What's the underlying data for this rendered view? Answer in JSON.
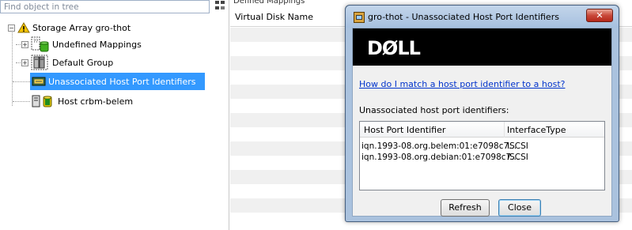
{
  "tree": {
    "find_placeholder": "Find object in tree",
    "items": [
      {
        "label": "Storage Array gro-thot",
        "icon": "warning-icon"
      },
      {
        "label": "Undefined Mappings",
        "icon": "undefined-mappings-icon"
      },
      {
        "label": "Default Group",
        "icon": "host-group-icon"
      },
      {
        "label": "Unassociated Host Port Identifiers",
        "icon": "host-port-icon",
        "selected": true
      },
      {
        "label": "Host crbm-belem",
        "icon": "host-icon"
      }
    ]
  },
  "mappings": {
    "header": "Defined Mappings",
    "column": "Virtual Disk Name"
  },
  "dialog": {
    "title": "gro-thot - Unassociated Host Port Identifiers",
    "close_x": "✕",
    "brand": "DØLL",
    "help_link": "How do I match a host port identifier to a host?",
    "list_caption": "Unassociated host port identifiers:",
    "columns": [
      "Host Port Identifier",
      "InterfaceType"
    ],
    "rows": [
      {
        "identifier": "iqn.1993-08.org.belem:01:e7098c7...",
        "type": "ISCSI"
      },
      {
        "identifier": "iqn.1993-08.org.debian:01:e7098c7...",
        "type": "ISCSI"
      }
    ],
    "refresh_label": "Refresh",
    "close_label": "Close"
  }
}
